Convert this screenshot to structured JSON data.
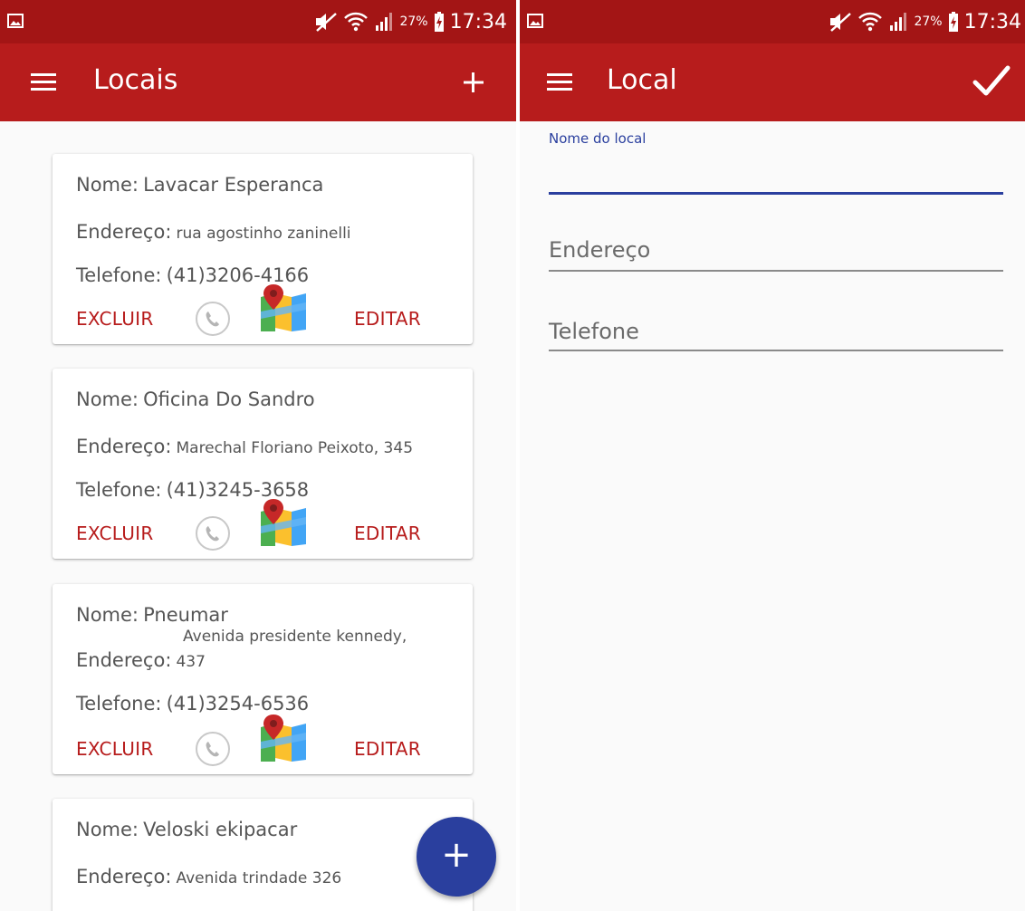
{
  "status_bar": {
    "time": "17:34",
    "battery": "27%"
  },
  "colors": {
    "primary": "#b71c1c",
    "status": "#a31515",
    "accent": "#2a3f9e",
    "text": "#555555"
  },
  "list_screen": {
    "title": "Locais",
    "menu_icon": "hamburger-menu-icon",
    "add_icon": "plus-icon",
    "fab_label": "+",
    "labels": {
      "name": "Nome:",
      "address": "Endereço:",
      "phone": "Telefone:"
    },
    "actions": {
      "delete": "EXCLUIR",
      "edit": "EDITAR"
    },
    "places": [
      {
        "name": "Lavacar Esperanca",
        "address": "rua agostinho zaninelli",
        "phone": "(41)3206-4166"
      },
      {
        "name": "Oficina Do Sandro",
        "address": "Marechal Floriano Peixoto, 345",
        "phone": "(41)3245-3658"
      },
      {
        "name": "Pneumar",
        "address_line1": "Avenida presidente kennedy,",
        "address_line2": "437",
        "phone": "(41)3254-6536"
      },
      {
        "name": "Veloski ekipacar",
        "address": "Avenida trindade 326"
      }
    ]
  },
  "form_screen": {
    "title": "Local",
    "confirm_icon": "checkmark-icon",
    "fields": {
      "name_label": "Nome do local",
      "name_value": "",
      "address_placeholder": "Endereço",
      "phone_placeholder": "Telefone"
    }
  }
}
